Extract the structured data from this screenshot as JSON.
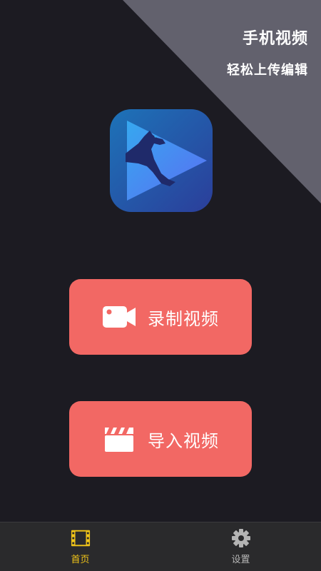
{
  "hero": {
    "slogan_line1": "手机视频",
    "slogan_line2": "轻松上传编辑"
  },
  "actions": {
    "record_label": "录制视频",
    "import_label": "导入视频"
  },
  "tabbar": {
    "home_label": "首页",
    "settings_label": "设置"
  },
  "icons": {
    "logo": "kangaroo-play-icon",
    "record": "video-camera-icon",
    "import": "clapperboard-icon",
    "home": "film-frame-icon",
    "settings": "gear-icon"
  },
  "colors": {
    "background": "#1c1b22",
    "corner": "#62616d",
    "button": "#f26864",
    "tab_active": "#f0c419",
    "tab_inactive": "#b4b4b4",
    "tabbar": "#2a2a2c"
  }
}
